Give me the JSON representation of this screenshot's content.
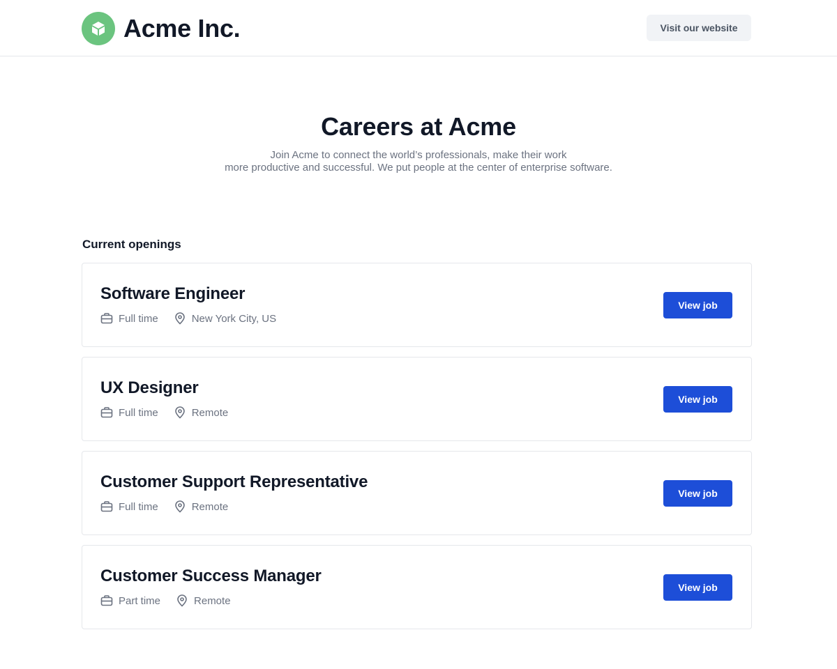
{
  "header": {
    "brand_name": "Acme Inc.",
    "logo_icon": "cube-icon",
    "logo_color": "#6bc47f",
    "website_button_label": "Visit our website"
  },
  "hero": {
    "title": "Careers at Acme",
    "description_line1": "Join Acme to connect the world’s professionals, make their work",
    "description_line2": "more productive and successful. We put people at the center of enterprise software."
  },
  "openings": {
    "section_title": "Current openings",
    "jobs": [
      {
        "title": "Software Engineer",
        "employment_type": "Full time",
        "location": "New York City, US",
        "button_label": "View job"
      },
      {
        "title": "UX Designer",
        "employment_type": "Full time",
        "location": "Remote",
        "button_label": "View job"
      },
      {
        "title": "Customer Support Representative",
        "employment_type": "Full time",
        "location": "Remote",
        "button_label": "View job"
      },
      {
        "title": "Customer Success Manager",
        "employment_type": "Part time",
        "location": "Remote",
        "button_label": "View job"
      }
    ]
  },
  "colors": {
    "primary_button": "#1d4ed8",
    "heading_text": "#111827",
    "muted_text": "#6b7280",
    "card_border": "#e5e7eb"
  }
}
